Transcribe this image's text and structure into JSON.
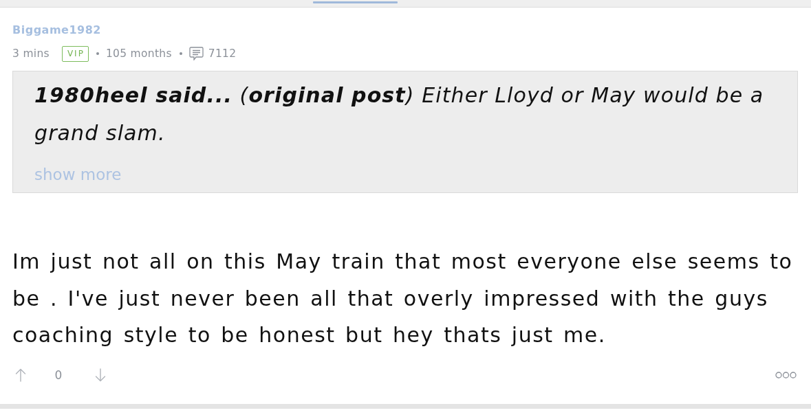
{
  "comment": {
    "author": "Biggame1982",
    "time": "3 mins",
    "badge": "VIP",
    "tenure": "105 months",
    "post_count": "7112"
  },
  "quote": {
    "text": "**1980heel said...** (**original post**) Either Lloyd or May would be a grand slam.",
    "show_more": "show more"
  },
  "body": "Im just not all on this May train that most everyone else seems to be . I've just never been all that overly impressed with the guys coaching style to be honest but hey thats just me.",
  "votes": {
    "score": "0"
  }
}
